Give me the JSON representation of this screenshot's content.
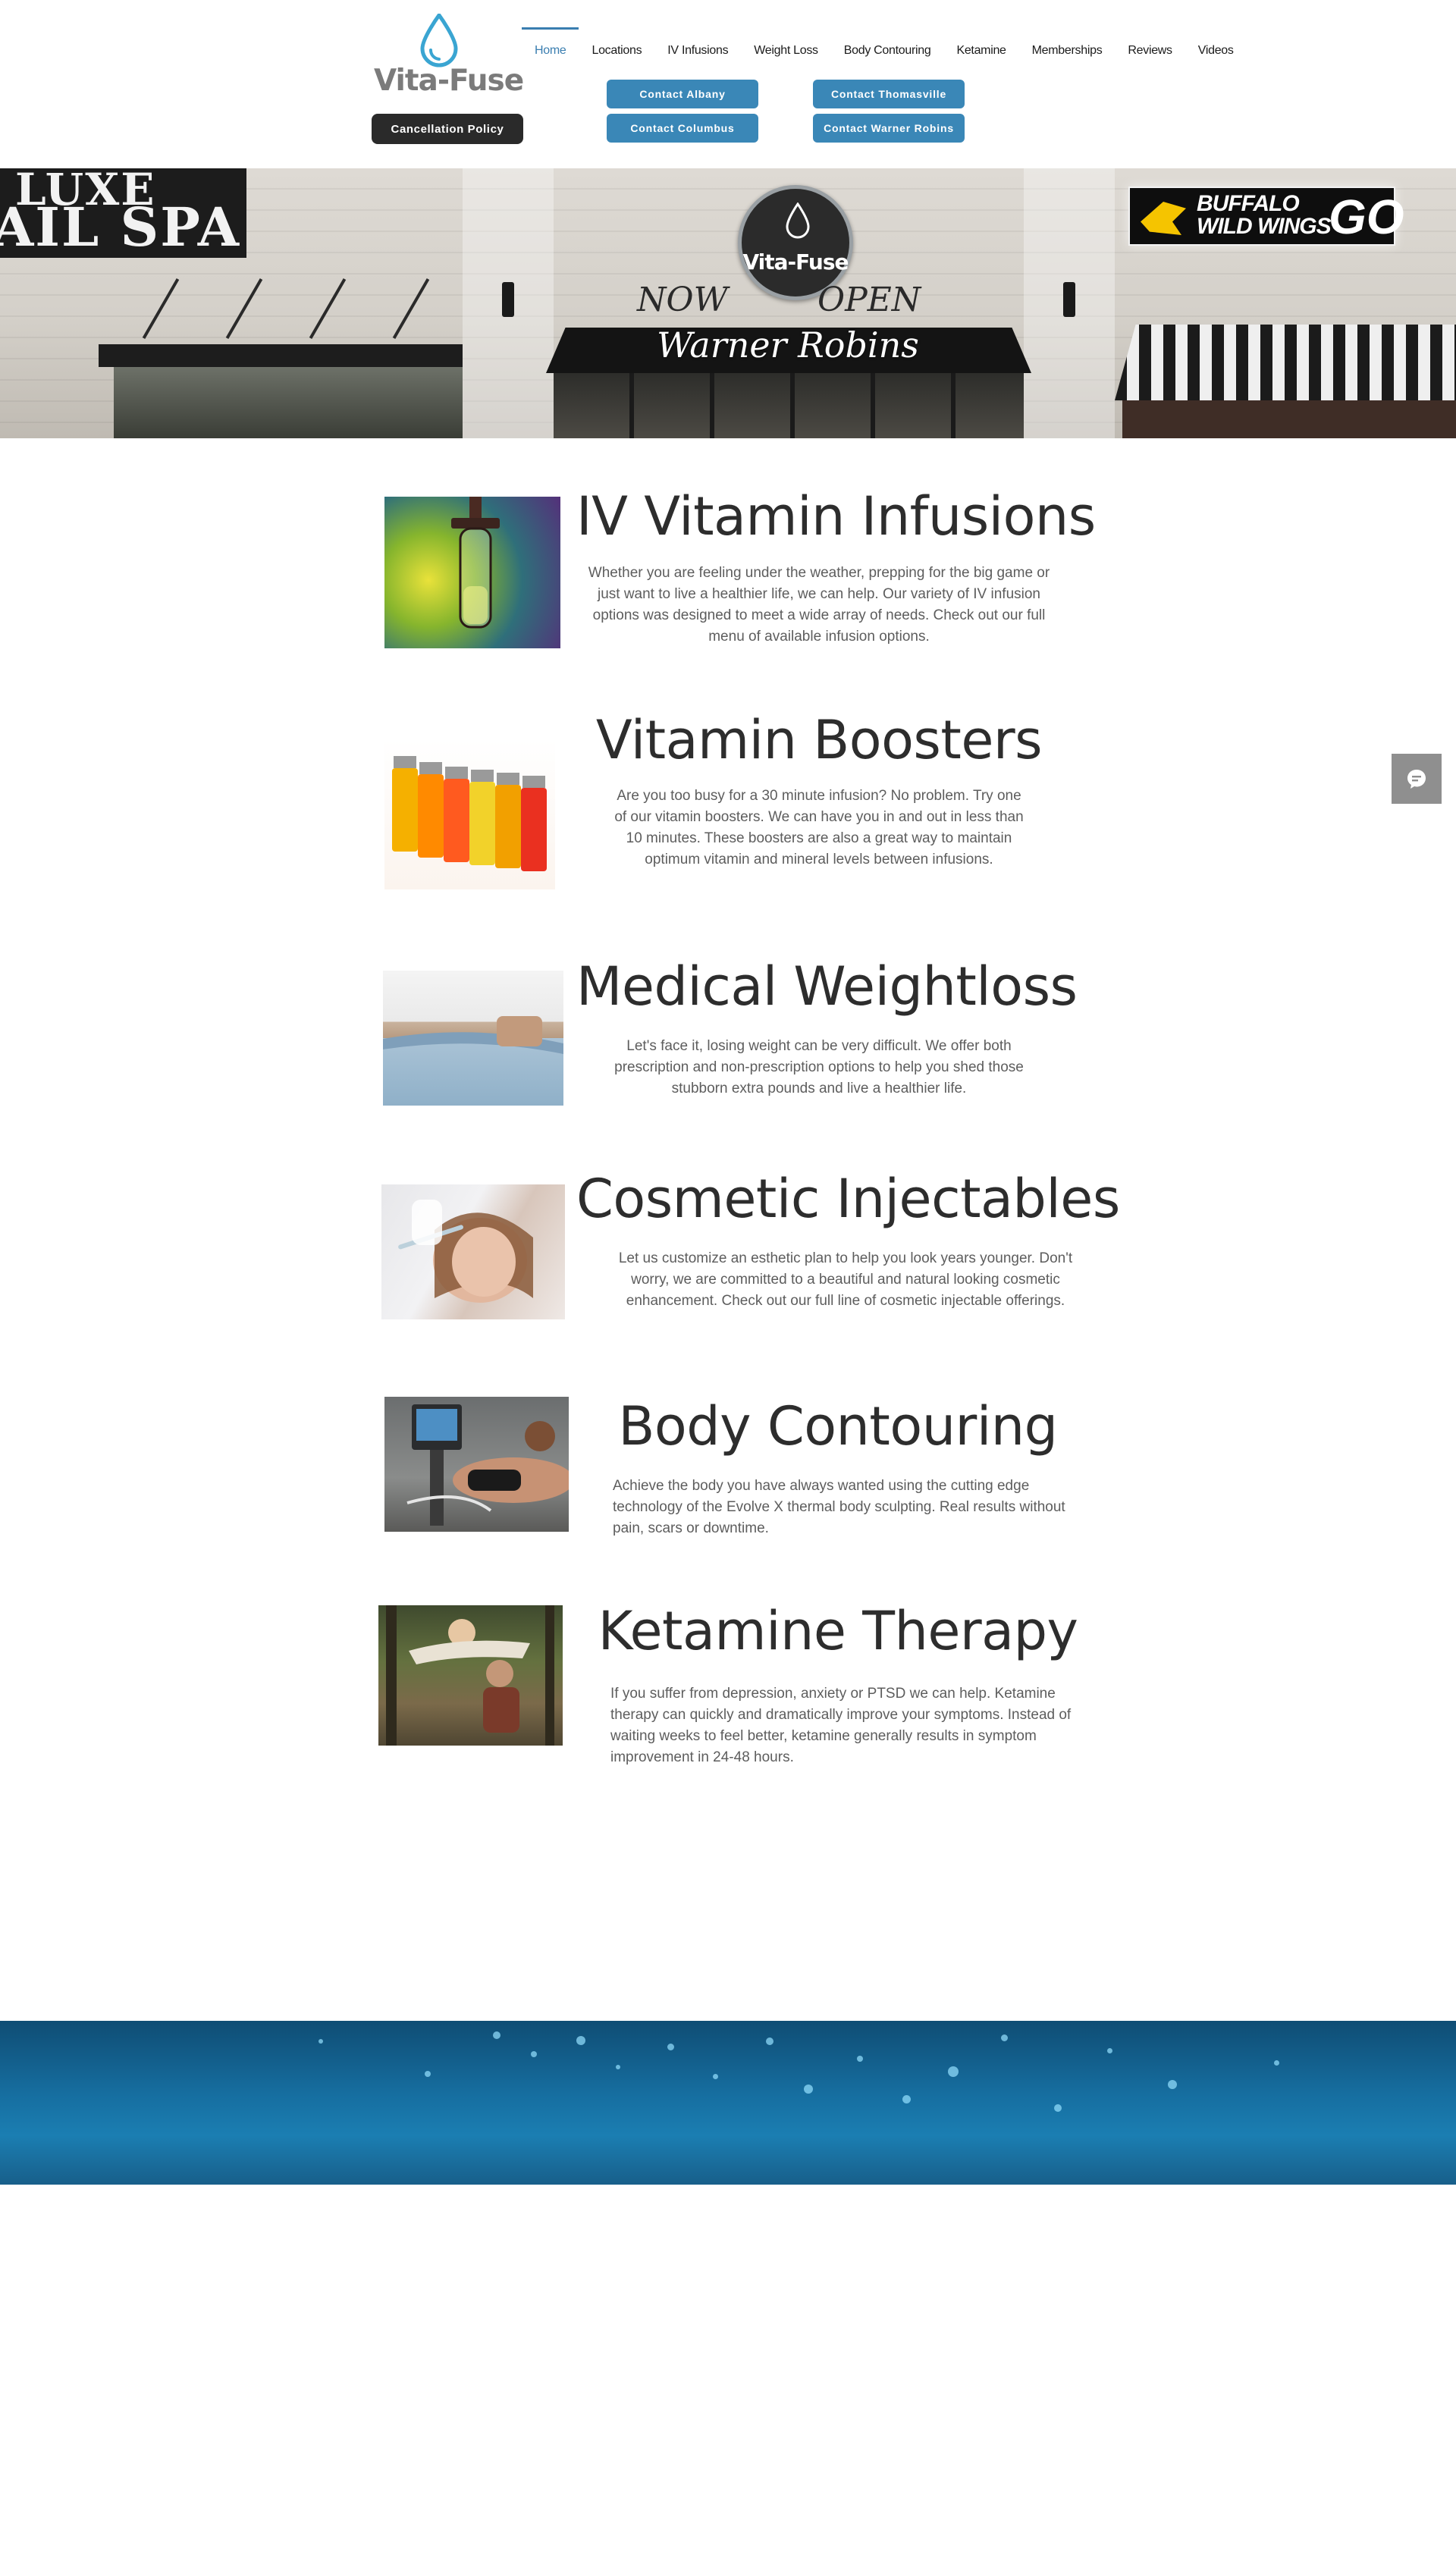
{
  "brand": {
    "name": "Vita-Fuse",
    "accent": "#3a87b7",
    "dark": "#2a2a2a"
  },
  "header": {
    "cancellation_label": "Cancellation Policy",
    "nav": [
      {
        "label": "Home",
        "active": true
      },
      {
        "label": "Locations"
      },
      {
        "label": "IV Infusions"
      },
      {
        "label": "Weight Loss"
      },
      {
        "label": "Body Contouring"
      },
      {
        "label": "Ketamine"
      },
      {
        "label": "Memberships"
      },
      {
        "label": "Reviews"
      },
      {
        "label": "Videos"
      }
    ],
    "contacts": [
      {
        "label": "Contact Albany"
      },
      {
        "label": "Contact Thomasville"
      },
      {
        "label": "Contact Columbus"
      },
      {
        "label": "Contact Warner Robins"
      }
    ]
  },
  "hero": {
    "left_sign_line1": "LUXE",
    "left_sign_line2": "AIL SPA",
    "storefront_logo": "Vita-Fuse",
    "now": "NOW",
    "open": "OPEN",
    "location": "Warner Robins",
    "right_sign_line1": "BUFFALO",
    "right_sign_line2": "WILD WINGS",
    "right_sign_go": "GO"
  },
  "services": [
    {
      "title": "IV Vitamin Infusions",
      "description": "Whether you are feeling under the weather, prepping for the big game or just want to live a healthier life, we can help.  Our variety of IV infusion options was designed to meet a wide array of needs.  Check out our full menu of available infusion options.",
      "image": "iv-drip-photo"
    },
    {
      "title": "Vitamin Boosters",
      "description": "Are you too busy for a 30 minute infusion? No problem. Try one of our vitamin boosters.  We can have you in and out in less than 10 minutes.  These boosters are also a great way to maintain optimum vitamin and mineral levels between infusions.",
      "image": "vials-photo"
    },
    {
      "title": "Medical Weightloss",
      "description": "Let's face it, losing weight can be very difficult.  We offer both prescription and non-prescription options to help you shed those stubborn extra pounds and live a healthier life.",
      "image": "waist-photo"
    },
    {
      "title": "Cosmetic Injectables",
      "description": "Let us customize an esthetic plan to help you look years younger. Don't worry, we are committed to a beautiful and natural looking cosmetic enhancement. Check out our full line of cosmetic injectable offerings.",
      "image": "injectable-photo"
    },
    {
      "title": "Body Contouring",
      "description": "Achieve the body you have always wanted using the cutting edge technology of the Evolve X thermal body sculpting.  Real results without pain, scars or downtime.",
      "image": "contouring-photo"
    },
    {
      "title": "Ketamine Therapy",
      "description": "If you suffer from depression, anxiety or PTSD we can help.  Ketamine therapy can quickly and dramatically improve your symptoms.  Instead of waiting weeks to feel better, ketamine generally results in symptom improvement in 24-48 hours.",
      "image": "couple-photo"
    }
  ],
  "chat": {
    "icon": "chat-icon"
  }
}
